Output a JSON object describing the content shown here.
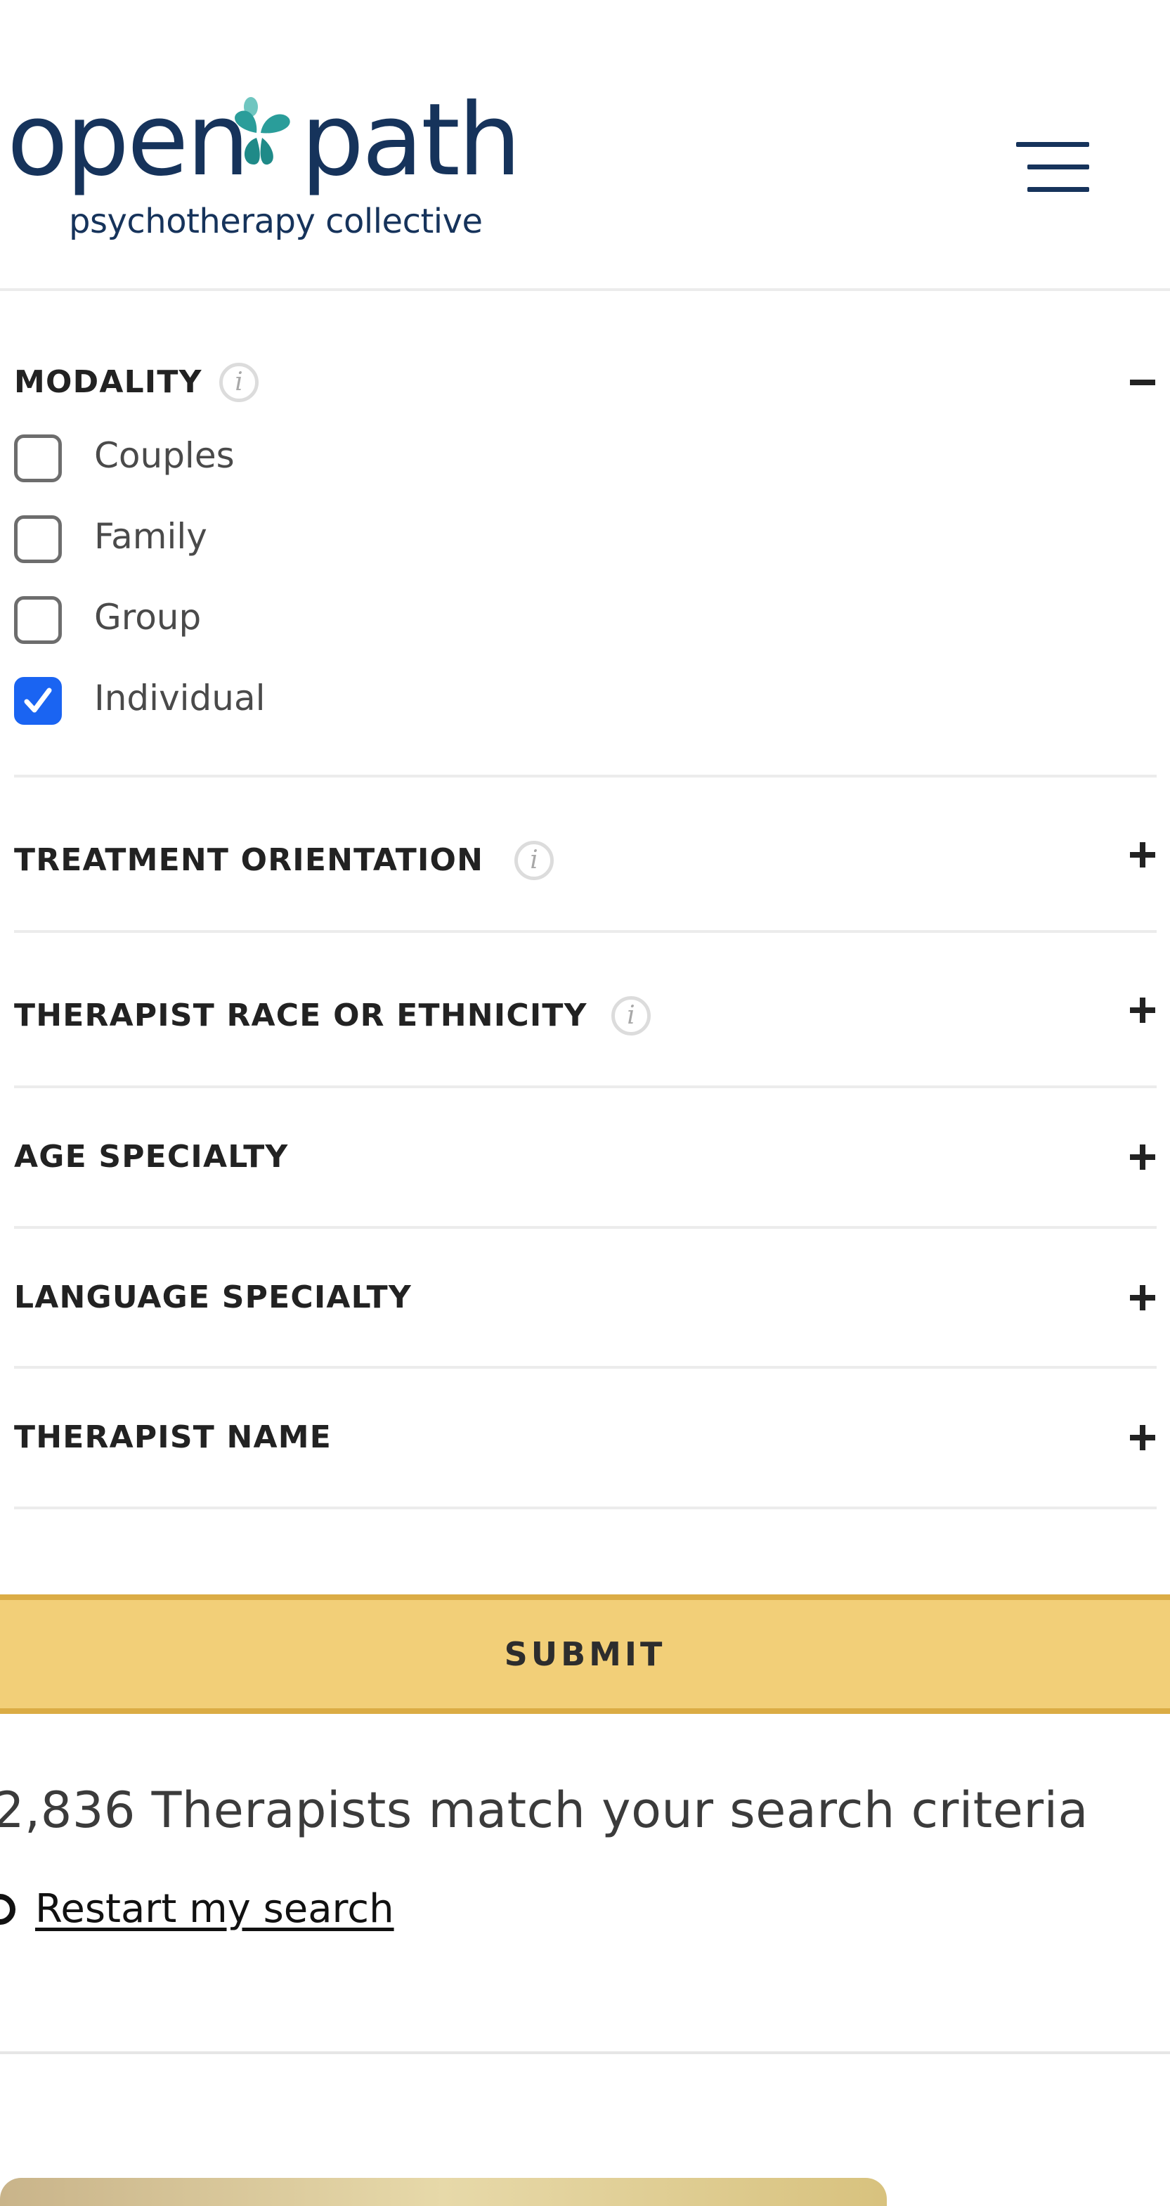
{
  "header": {
    "logo": {
      "word1": "open",
      "word2": "path",
      "tagline": "psychotherapy collective"
    },
    "menu_icon": "hamburger-menu-icon"
  },
  "filters": {
    "modality": {
      "title": "MODALITY",
      "expanded": true,
      "options": [
        {
          "label": "Couples",
          "checked": false
        },
        {
          "label": "Family",
          "checked": false
        },
        {
          "label": "Group",
          "checked": false
        },
        {
          "label": "Individual",
          "checked": true
        }
      ]
    },
    "treatment_orientation": {
      "title": "TREATMENT ORIENTATION",
      "expanded": false
    },
    "therapist_race": {
      "title": "THERAPIST RACE OR ETHNICITY",
      "expanded": false
    },
    "age_specialty": {
      "title": "AGE SPECIALTY",
      "expanded": false
    },
    "language_specialty": {
      "title": "LANGUAGE SPECIALTY",
      "expanded": false
    },
    "therapist_name": {
      "title": "THERAPIST NAME",
      "expanded": false
    }
  },
  "info_glyph": "i",
  "submit": {
    "label": "SUBMIT"
  },
  "results": {
    "text": "2,836 Therapists match your search criteria"
  },
  "restart": {
    "label": "Restart my search"
  },
  "colors": {
    "brand_navy": "#16335b",
    "brand_teal": "#2a9d9a",
    "submit_bg": "#f2cf78",
    "submit_border": "#dbac45",
    "checkbox_checked": "#1a64f2"
  }
}
